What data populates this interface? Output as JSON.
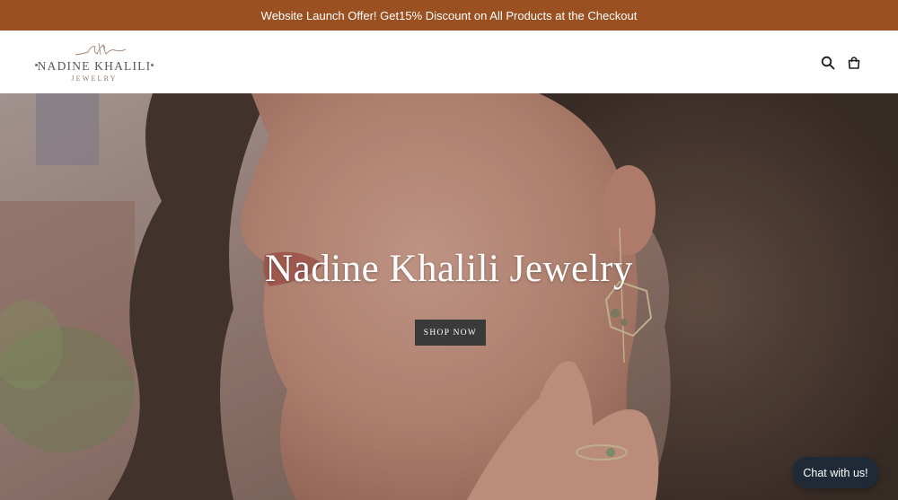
{
  "announcement": {
    "text": "Website Launch Offer! Get15% Discount on All Products at the Checkout",
    "background": "#9a5020"
  },
  "header": {
    "logo": {
      "name": "NADINE KHALILI",
      "subtitle": "JEWELRY"
    },
    "icons": [
      "search-icon",
      "cart-icon"
    ]
  },
  "hero": {
    "title": "Nadine Khalili Jewelry",
    "button_label": "SHOP NOW"
  },
  "chat": {
    "label": "Chat with us!"
  },
  "colors": {
    "accent": "#9a5020",
    "button_dark": "#3a3a3a",
    "chat_bg": "#1f2a36"
  }
}
